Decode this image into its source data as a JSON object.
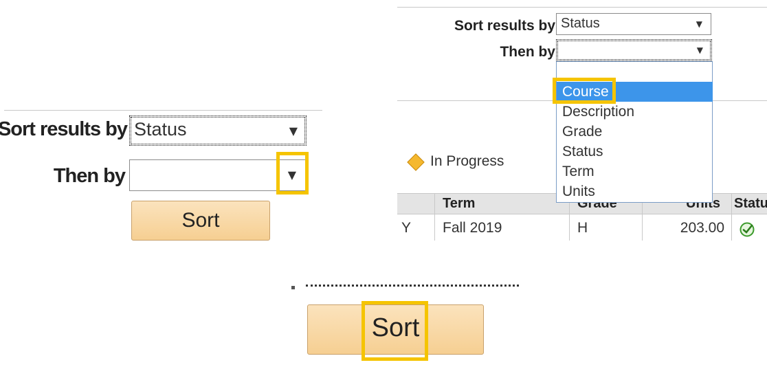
{
  "panel_left": {
    "sort_label": "Sort results by",
    "sort_value": "Status",
    "then_label": "Then by",
    "then_value": "",
    "button_label": "Sort",
    "arrow_glyph": "▼"
  },
  "panel_right": {
    "sort_label": "Sort results by",
    "sort_value": "Status",
    "then_label": "Then by",
    "then_value": "",
    "arrow_glyph": "▼",
    "dropdown_options": [
      "",
      "Course",
      "Description",
      "Grade",
      "Status",
      "Term",
      "Units"
    ],
    "dropdown_selected": "Course",
    "legend_icon": "diamond-icon",
    "legend_text": "In Progress",
    "table": {
      "headers": [
        "Term",
        "Grade",
        "Units",
        "Status"
      ],
      "row": {
        "first": "Y",
        "term": "Fall 2019",
        "grade": "H",
        "units": "203.00",
        "status_icon": "check-circle-icon"
      }
    }
  },
  "panel_bottom": {
    "button_label": "Sort"
  },
  "colors": {
    "highlight": "#f5c400",
    "button_top": "#fbe3bd",
    "button_bottom": "#f6cf92",
    "dropdown_selected": "#3d95ea",
    "diamond": "#f5b82e",
    "check": "#3a9a2a"
  }
}
